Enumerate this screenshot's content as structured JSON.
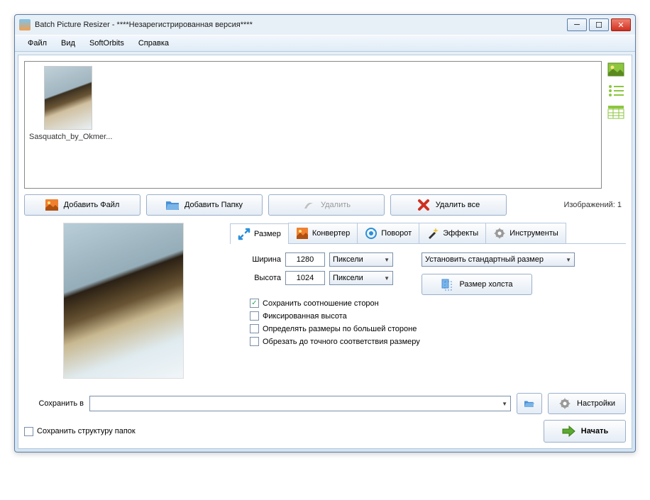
{
  "window": {
    "title": "Batch Picture Resizer - ****Незарегистрированная версия****"
  },
  "menu": {
    "file": "Файл",
    "view": "Вид",
    "softorbits": "SoftOrbits",
    "help": "Справка"
  },
  "thumbs": {
    "item0_label": "Sasquatch_by_Okmer..."
  },
  "toolbar": {
    "add_file": "Добавить Файл",
    "add_folder": "Добавить Папку",
    "delete": "Удалить",
    "delete_all": "Удалить все",
    "count_label": "Изображений: 1"
  },
  "tabs": {
    "size": "Размер",
    "converter": "Конвертер",
    "rotate": "Поворот",
    "effects": "Эффекты",
    "tools": "Инструменты"
  },
  "size_panel": {
    "width_label": "Ширина",
    "width_value": "1280",
    "height_label": "Высота",
    "height_value": "1024",
    "unit": "Пиксели",
    "std_size": "Установить стандартный размер",
    "canvas_size": "Размер холста",
    "keep_aspect": "Сохранить соотношение сторон",
    "fixed_height": "Фиксированная высота",
    "by_larger": "Определять размеры по большей стороне",
    "crop_exact": "Обрезать до точного соответствия размеру"
  },
  "save": {
    "label": "Сохранить в",
    "keep_structure": "Сохранить структуру папок",
    "settings": "Настройки",
    "start": "Начать"
  }
}
